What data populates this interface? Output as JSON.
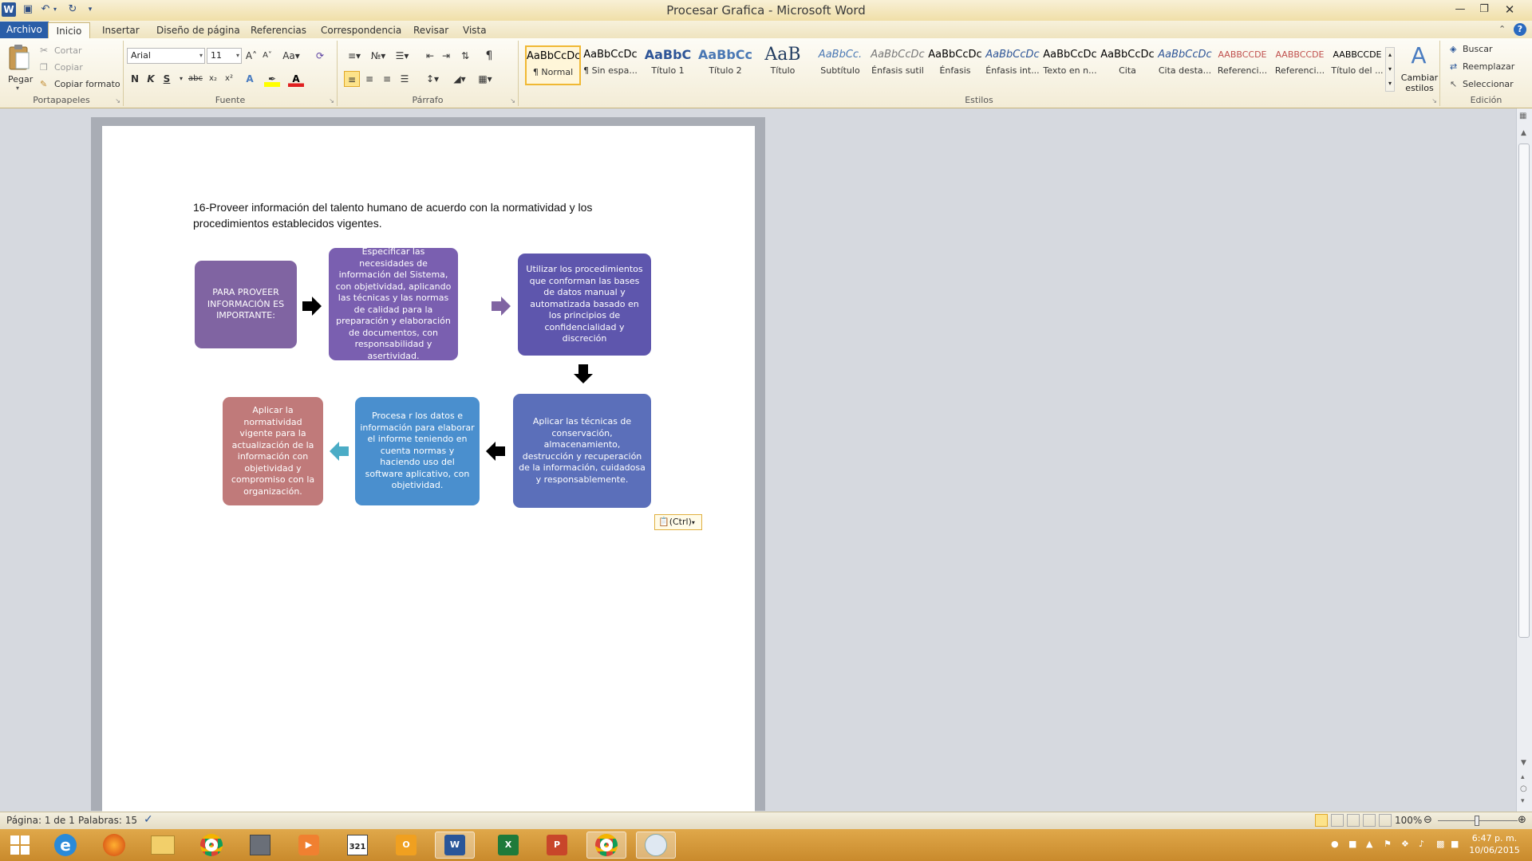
{
  "window": {
    "title": "Procesar Grafica  -  Microsoft Word"
  },
  "tabs": {
    "file": "Archivo",
    "items": [
      "Inicio",
      "Insertar",
      "Diseño de página",
      "Referencias",
      "Correspondencia",
      "Revisar",
      "Vista"
    ],
    "active": "Inicio"
  },
  "ribbon": {
    "clipboard": {
      "label": "Portapapeles",
      "paste": "Pegar",
      "cut": "Cortar",
      "copy": "Copiar",
      "format_painter": "Copiar formato"
    },
    "font": {
      "label": "Fuente",
      "family": "Arial",
      "size": "11",
      "bold": "N",
      "italic": "K",
      "underline": "S"
    },
    "paragraph": {
      "label": "Párrafo"
    },
    "styles": {
      "label": "Estilos",
      "change": "Cambiar estilos",
      "items": [
        {
          "preview": "AaBbCcDc",
          "name": "¶ Normal",
          "color": "#000000"
        },
        {
          "preview": "AaBbCcDc",
          "name": "¶ Sin espa...",
          "color": "#000000"
        },
        {
          "preview": "AaBbC",
          "name": "Título 1",
          "color": "#2e5597"
        },
        {
          "preview": "AaBbCc",
          "name": "Título 2",
          "color": "#4a78b4"
        },
        {
          "preview": "AaB",
          "name": "Título",
          "color": "#1f3a5f"
        },
        {
          "preview": "AaBbCc.",
          "name": "Subtítulo",
          "color": "#4a78b4"
        },
        {
          "preview": "AaBbCcDc",
          "name": "Énfasis sutil",
          "color": "#777777"
        },
        {
          "preview": "AaBbCcDc",
          "name": "Énfasis",
          "color": "#000000"
        },
        {
          "preview": "AaBbCcDc",
          "name": "Énfasis int...",
          "color": "#2e5597"
        },
        {
          "preview": "AaBbCcDc",
          "name": "Texto en n...",
          "color": "#000000"
        },
        {
          "preview": "AaBbCcDc",
          "name": "Cita",
          "color": "#000000"
        },
        {
          "preview": "AaBbCcDc",
          "name": "Cita desta...",
          "color": "#2e5597"
        },
        {
          "preview": "AABBCCDE",
          "name": "Referenci...",
          "color": "#c0504d"
        },
        {
          "preview": "AABBCCDE",
          "name": "Referenci...",
          "color": "#c0504d"
        },
        {
          "preview": "AABBCCDE",
          "name": "Título del ...",
          "color": "#000000"
        }
      ]
    },
    "editing": {
      "label": "Edición",
      "find": "Buscar",
      "replace": "Reemplazar",
      "select": "Seleccionar"
    }
  },
  "document": {
    "heading": "16-Proveer información del talento humano de acuerdo con la normatividad y los procedimientos establecidos vigentes.",
    "boxes": [
      {
        "text": "PARA PROVEER INFORMACIÓN ES IMPORTANTE:",
        "color": "#8064a2"
      },
      {
        "text": "Especificar las necesidades de información del Sistema, con objetividad, aplicando las técnicas y las normas de calidad para la preparación y elaboración de documentos, con responsabilidad y asertividad.",
        "color": "#7a5fb0"
      },
      {
        "text": "Utilizar los procedimientos que conforman las bases de datos manual y automatizada basado en los principios de confidencialidad y discreción",
        "color": "#5e56ad"
      },
      {
        "text": "Aplicar las técnicas de conservación, almacenamiento, destrucción y recuperación de la información, cuidadosa y responsablemente.",
        "color": "#5b6fba"
      },
      {
        "text": "Procesa r los datos e información para elaborar el informe teniendo en cuenta normas y haciendo uso del software aplicativo, con objetividad.",
        "color": "#4a8fce"
      },
      {
        "text": "Aplicar la normatividad vigente para la actualización de la información con objetividad y compromiso con la organización.",
        "color": "#c07a7a"
      }
    ],
    "arrow_colors": {
      "black": "#000000",
      "purple": "#8064a2",
      "teal": "#4bacc6"
    },
    "paste_options": "(Ctrl)"
  },
  "status": {
    "page": "Página: 1 de 1",
    "words": "Palabras: 15",
    "zoom": "100%"
  },
  "taskbar": {
    "apps": [
      "start",
      "internet-explorer",
      "firefox",
      "file-explorer",
      "chrome",
      "calculator",
      "media-player",
      "calendar",
      "outlook",
      "word",
      "excel",
      "powerpoint",
      "chrome",
      "paint"
    ],
    "active": "word",
    "time": "6:47 p. m.",
    "date": "10/06/2015"
  }
}
